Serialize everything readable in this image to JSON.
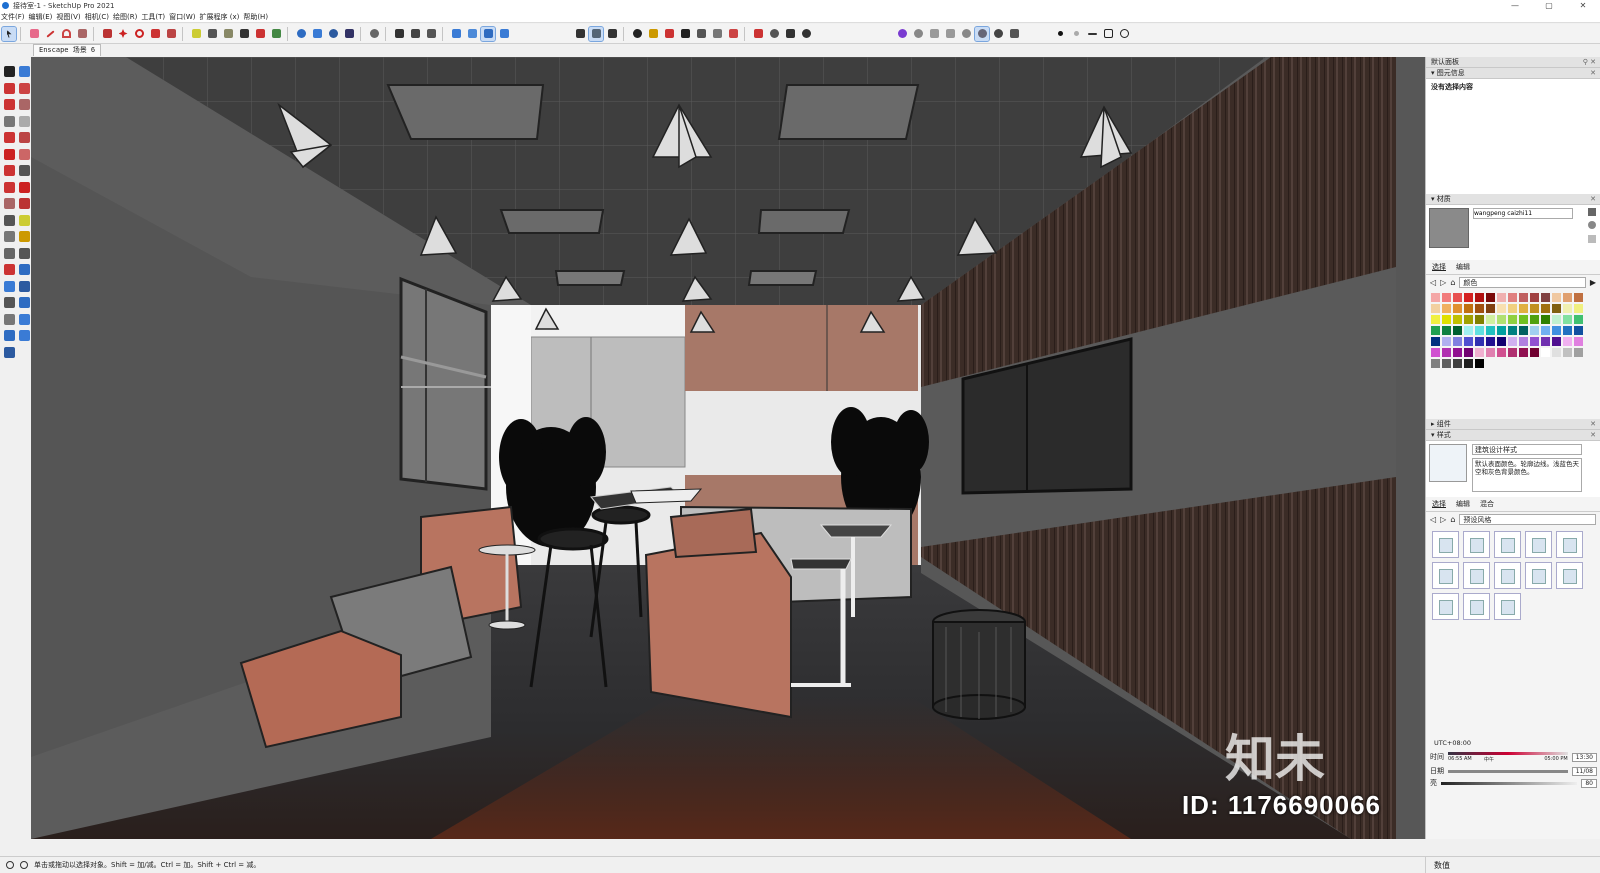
{
  "window": {
    "title": "接待室-1 - SketchUp Pro 2021",
    "controls": [
      "—",
      "▢",
      "✕"
    ]
  },
  "menu": [
    "文件(F)",
    "编辑(E)",
    "视图(V)",
    "相机(C)",
    "绘图(R)",
    "工具(T)",
    "窗口(W)",
    "扩展程序 (x)",
    "帮助(H)"
  ],
  "scene_tab": "Enscape 场景 6",
  "panel": {
    "default_tray": "默认面板",
    "entity_info": {
      "title": "图元信息",
      "empty_text": "没有选择内容"
    },
    "materials": {
      "title": "材质",
      "material_name": "wangpeng caizhi11",
      "tabs": [
        "选择",
        "编辑"
      ],
      "library": "颜色",
      "swatch_colors": [
        "#f4a7a7",
        "#f27c7c",
        "#e85050",
        "#d42020",
        "#b01010",
        "#7a0a0a",
        "#f0b0b0",
        "#e08080",
        "#c06060",
        "#a04040",
        "#804040",
        "#f0c8a0",
        "#e0a070",
        "#c07040",
        "#f2d0a0",
        "#f0b060",
        "#e09030",
        "#c07010",
        "#a05010",
        "#804010",
        "#f8e0b0",
        "#f0d080",
        "#e0b040",
        "#c09020",
        "#a07010",
        "#806010",
        "#f0f0b0",
        "#f0f080",
        "#f0f040",
        "#e0e000",
        "#c0c000",
        "#a0a000",
        "#808000",
        "#d0f0a0",
        "#b0e070",
        "#90d040",
        "#70c020",
        "#50a010",
        "#308000",
        "#c0f0d0",
        "#80e0a0",
        "#40c070",
        "#20a050",
        "#108040",
        "#006030",
        "#a0f0f0",
        "#60e0e0",
        "#20c0c0",
        "#00a0a0",
        "#008080",
        "#006060",
        "#a0d0f0",
        "#70b0f0",
        "#4090e0",
        "#2070c0",
        "#1050a0",
        "#003080",
        "#b0b0f0",
        "#8080e0",
        "#5050d0",
        "#3030b0",
        "#201090",
        "#100070",
        "#d0b0f0",
        "#b080e0",
        "#9050d0",
        "#7030b0",
        "#501090",
        "#f0b0f0",
        "#e080e0",
        "#d050d0",
        "#b030b0",
        "#901090",
        "#700070",
        "#f0b0d0",
        "#e080b0",
        "#d05090",
        "#b03070",
        "#901050",
        "#700030",
        "#ffffff",
        "#e0e0e0",
        "#c0c0c0",
        "#a0a0a0",
        "#808080",
        "#606060",
        "#404040",
        "#202020",
        "#000000"
      ]
    },
    "components": {
      "title": "组件"
    },
    "styles": {
      "title": "样式",
      "style_name": "建筑设计样式",
      "style_desc": "默认表面颜色。轮廓边线。浅蓝色天空和灰色背景颜色。",
      "tabs": [
        "选择",
        "编辑",
        "混合"
      ],
      "library": "预设风格"
    },
    "shadows": {
      "utc": "UTC+08:00",
      "time_label": "时间",
      "date_label": "日期",
      "time_start": "06:55 AM",
      "noon": "中午",
      "time_end": "05:00 PM",
      "time_value": "13:30",
      "date_value": "11/08",
      "light_label": "亮",
      "light_value": "80"
    }
  },
  "status": {
    "hint": "单击或拖动以选择对象。Shift = 加/减。Ctrl = 加。Shift + Ctrl = 减。",
    "measure_label": "数值"
  },
  "watermark": {
    "id_text": "ID: 1176690066",
    "logo_text": "知未"
  },
  "colors": {
    "accent": "#1d6fd1",
    "wood_wall": "#3b2a24",
    "sofa_leather": "#b87460",
    "floor": "#2e2e30",
    "ceiling": "#404040"
  }
}
